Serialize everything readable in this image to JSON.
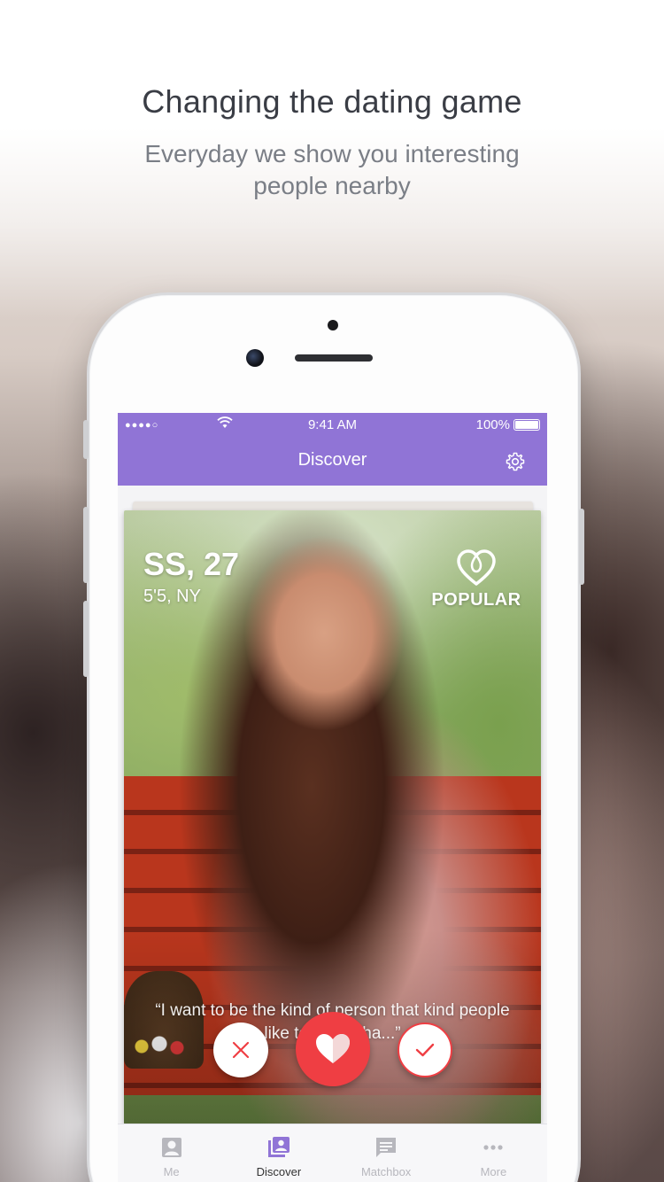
{
  "marketing": {
    "headline": "Changing the dating game",
    "subline": "Everyday we show you interesting people nearby"
  },
  "statusbar": {
    "signal": "●●●●○",
    "time": "9:41 AM",
    "battery": "100%"
  },
  "navbar": {
    "title": "Discover",
    "settings_icon": "gear-icon"
  },
  "profile": {
    "name_age": "SS, 27",
    "details": "5'5, NY",
    "badge": "POPULAR",
    "badge_icon": "heart-outline-icon",
    "quote": "“I want to be the kind of person that kind people like to talk to ha...”"
  },
  "actions": {
    "reject_icon": "close-icon",
    "like_icon": "heart-icon",
    "accept_icon": "check-icon"
  },
  "tabs": [
    {
      "label": "Me",
      "icon": "person-icon"
    },
    {
      "label": "Discover",
      "icon": "cards-icon"
    },
    {
      "label": "Matchbox",
      "icon": "chat-icon"
    },
    {
      "label": "More",
      "icon": "more-icon"
    }
  ],
  "colors": {
    "accent": "#9074d6",
    "like": "#ef3e43",
    "tab_active": "#9074d6",
    "tab_inactive": "#b7b7bd"
  }
}
